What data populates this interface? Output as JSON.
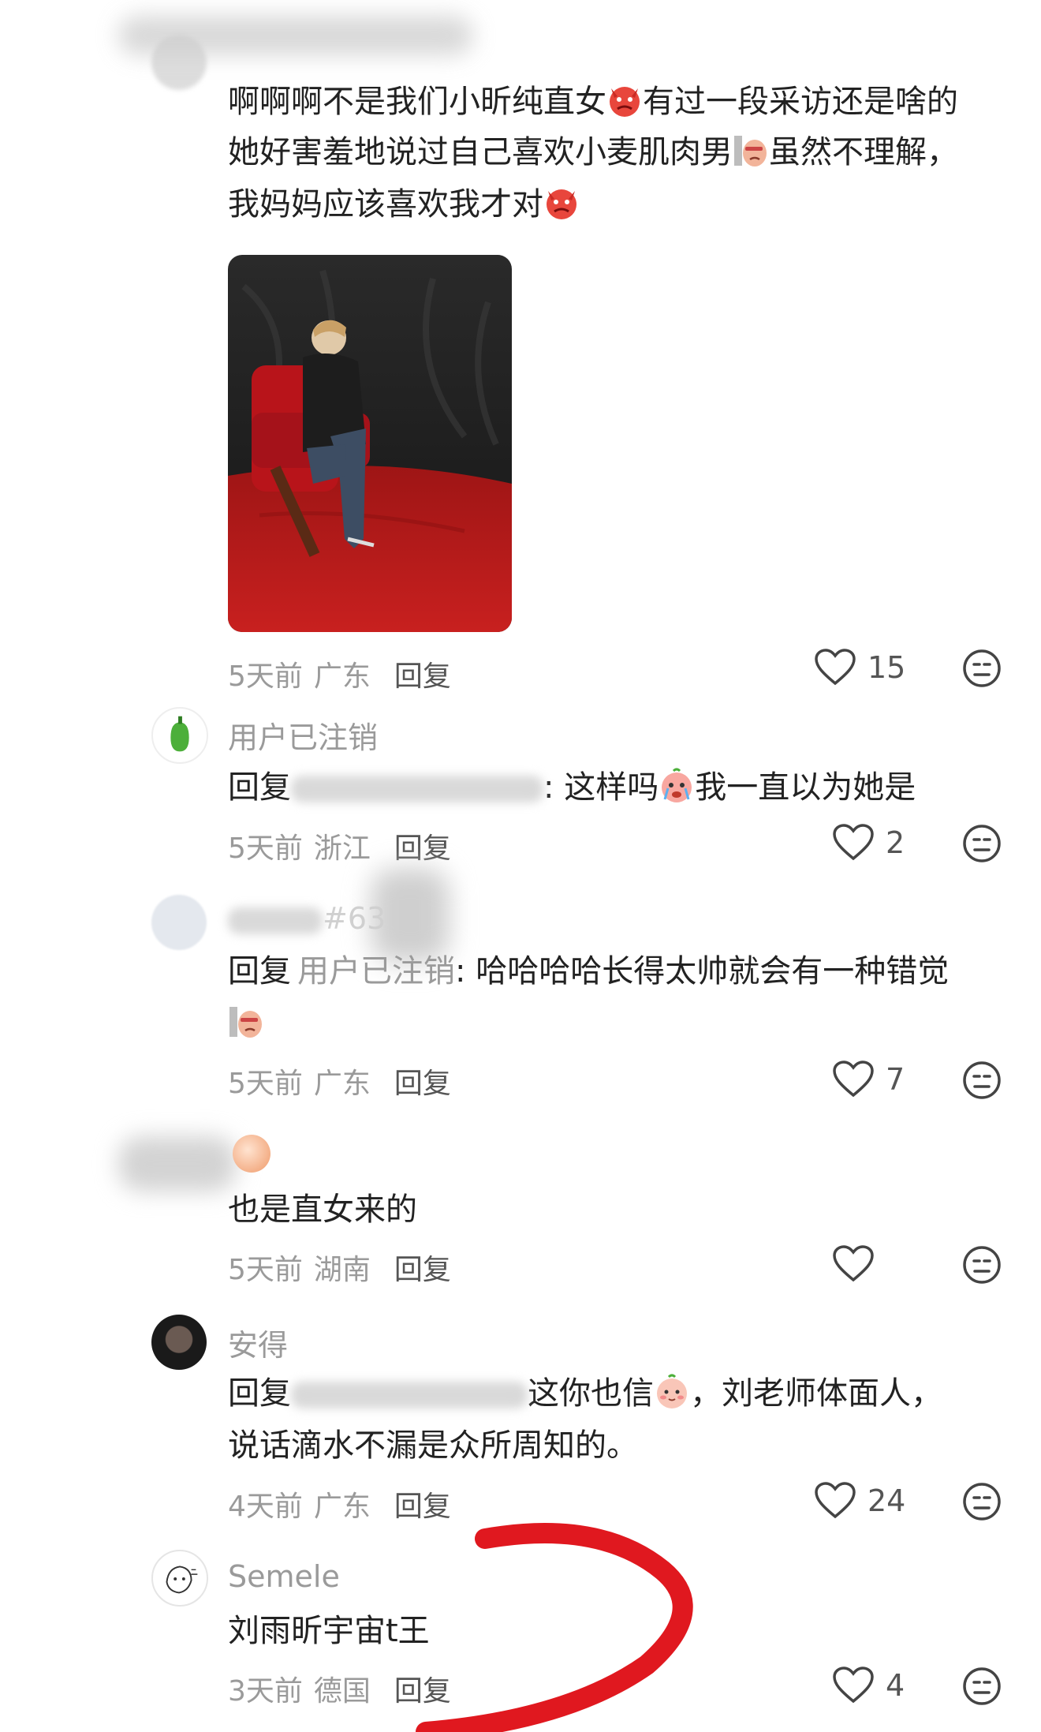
{
  "comments": [
    {
      "lines": [
        "啊啊啊不是我们小昕纯直女",
        "有过一段采访还是啥的",
        "她好害羞地说过自己喜欢小麦肌肉男",
        "虽然不理解，",
        "我妈妈应该喜欢我才对"
      ],
      "time": "5天前",
      "location": "广东",
      "reply": "回复",
      "likes": "15"
    },
    {
      "name": "用户已注销",
      "reply_prefix": "回复",
      "text": ": 这样吗",
      "text2": "我一直以为她是",
      "time": "5天前",
      "location": "浙江",
      "reply": "回复",
      "likes": "2"
    },
    {
      "name_suffix": "#63",
      "reply_prefix": "回复",
      "reply_to": "用户已注销",
      "text": ": 哈哈哈哈长得太帅就会有一种错觉",
      "time": "5天前",
      "location": "广东",
      "reply": "回复",
      "likes": "7"
    },
    {
      "text": "也是直女来的",
      "time": "5天前",
      "location": "湖南",
      "reply": "回复"
    },
    {
      "name": "安得",
      "reply_prefix": "回复",
      "text": "这你也信",
      "text2": "，刘老师体面人，",
      "line2": "说话滴水不漏是众所周知的。",
      "time": "4天前",
      "location": "广东",
      "reply": "回复",
      "likes": "24"
    },
    {
      "name": "Semele",
      "text": "刘雨昕宇宙t王",
      "time": "3天前",
      "location": "德国",
      "reply": "回复",
      "likes": "4"
    }
  ],
  "icons": {
    "like": "heart-outline-icon",
    "dislike": "dislike-face-icon",
    "emoji_angry": "angry-devil-emoji",
    "emoji_peek": "peeking-emoji",
    "emoji_cry": "crying-emoji",
    "emoji_blush": "blush-emoji"
  },
  "colors": {
    "annotation": "#e0181f",
    "chair": "#b8141a",
    "muted": "#9a9a9a"
  }
}
